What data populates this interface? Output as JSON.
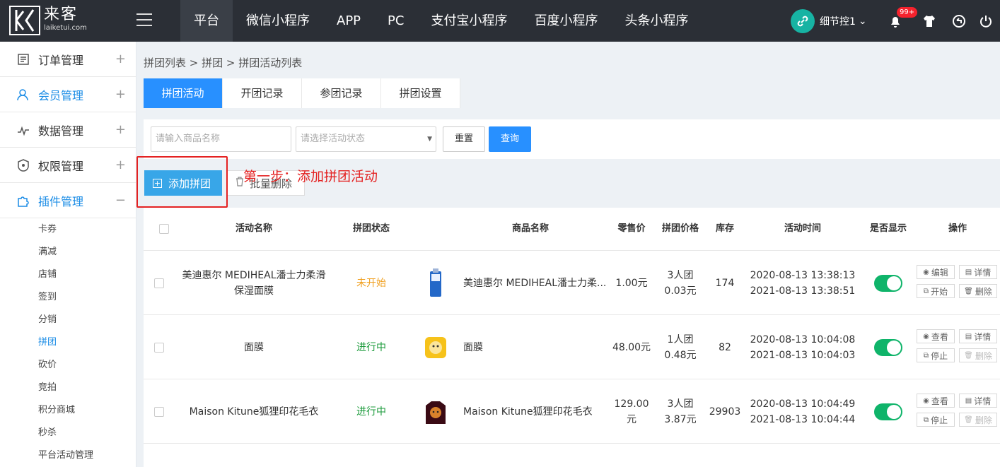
{
  "header": {
    "logo_cn": "来客",
    "logo_en": "laiketui.com",
    "nav": [
      "平台",
      "微信小程序",
      "APP",
      "PC",
      "支付宝小程序",
      "百度小程序",
      "头条小程序"
    ],
    "user": "细节控1",
    "badge": "99+"
  },
  "sidebar": {
    "menus": [
      "订单管理",
      "会员管理",
      "数据管理",
      "权限管理",
      "插件管理"
    ],
    "subs": [
      "卡券",
      "满减",
      "店铺",
      "签到",
      "分销",
      "拼团",
      "砍价",
      "竞拍",
      "积分商城",
      "秒杀",
      "平台活动管理"
    ]
  },
  "breadcrumb": "拼团列表 > 拼团 > 拼团活动列表",
  "tabs": [
    "拼团活动",
    "开团记录",
    "参团记录",
    "拼团设置"
  ],
  "filter": {
    "name_placeholder": "请输入商品名称",
    "status_placeholder": "请选择活动状态",
    "reset": "重置",
    "query": "查询"
  },
  "actions": {
    "add": "添加拼团",
    "batch_delete": "批量删除",
    "annotation": "第一步：添加拼团活动"
  },
  "table": {
    "headers": [
      "活动名称",
      "拼团状态",
      "商品名称",
      "零售价",
      "拼团价格",
      "库存",
      "活动时间",
      "是否显示",
      "操作"
    ],
    "rows": [
      {
        "name": "美迪惠尔 MEDIHEAL潘士力柔滑保湿面膜",
        "status": "未开始",
        "status_color": "#f0a020",
        "product": "美迪惠尔 MEDIHEAL潘士力柔...",
        "price": "1.00元",
        "group_a": "3人团",
        "group_b": "0.03元",
        "stock": "174",
        "t1": "2020-08-13 13:38:13",
        "t2": "2021-08-13 13:38:51",
        "ops": [
          "编辑",
          "详情",
          "开始",
          "删除"
        ]
      },
      {
        "name": "面膜",
        "status": "进行中",
        "status_color": "#1a9a3a",
        "product": "面膜",
        "price": "48.00元",
        "group_a": "1人团",
        "group_b": "0.48元",
        "stock": "82",
        "t1": "2020-08-13 10:04:08",
        "t2": "2021-08-13 10:04:03",
        "ops": [
          "查看",
          "详情",
          "停止",
          "删除"
        ]
      },
      {
        "name": "Maison Kitune狐狸印花毛衣",
        "status": "进行中",
        "status_color": "#1a9a3a",
        "product": "Maison Kitune狐狸印花毛衣",
        "price": "129.00元",
        "group_a": "3人团",
        "group_b": "3.87元",
        "stock": "29903",
        "t1": "2020-08-13 10:04:49",
        "t2": "2021-08-13 10:04:44",
        "ops": [
          "查看",
          "详情",
          "停止",
          "删除"
        ]
      }
    ]
  }
}
